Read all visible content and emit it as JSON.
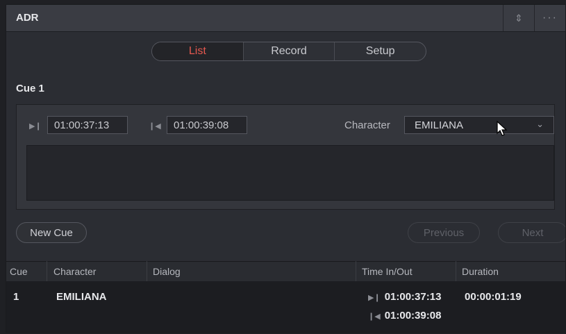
{
  "header": {
    "title": "ADR",
    "sort_icon": "up-down-arrows-icon",
    "more_icon": "ellipsis-icon"
  },
  "tabs": [
    {
      "label": "List",
      "active": true
    },
    {
      "label": "Record",
      "active": false
    },
    {
      "label": "Setup",
      "active": false
    }
  ],
  "cue": {
    "label": "Cue 1",
    "time_in": "01:00:37:13",
    "time_out": "01:00:39:08",
    "character_label": "Character",
    "character_value": "EMILIANA",
    "dialog": ""
  },
  "buttons": {
    "new_cue": "New Cue",
    "previous": "Previous",
    "next": "Next"
  },
  "table": {
    "headers": [
      "Cue",
      "Character",
      "Dialog",
      "Time In/Out",
      "Duration"
    ],
    "rows": [
      {
        "cue": "1",
        "character": "EMILIANA",
        "dialog": "",
        "time_in": "01:00:37:13",
        "time_out": "01:00:39:08",
        "duration": "00:00:01:19"
      }
    ]
  },
  "colors": {
    "active_tab": "#e5584f",
    "panel": "#2b2d33",
    "header": "#3a3c43"
  }
}
